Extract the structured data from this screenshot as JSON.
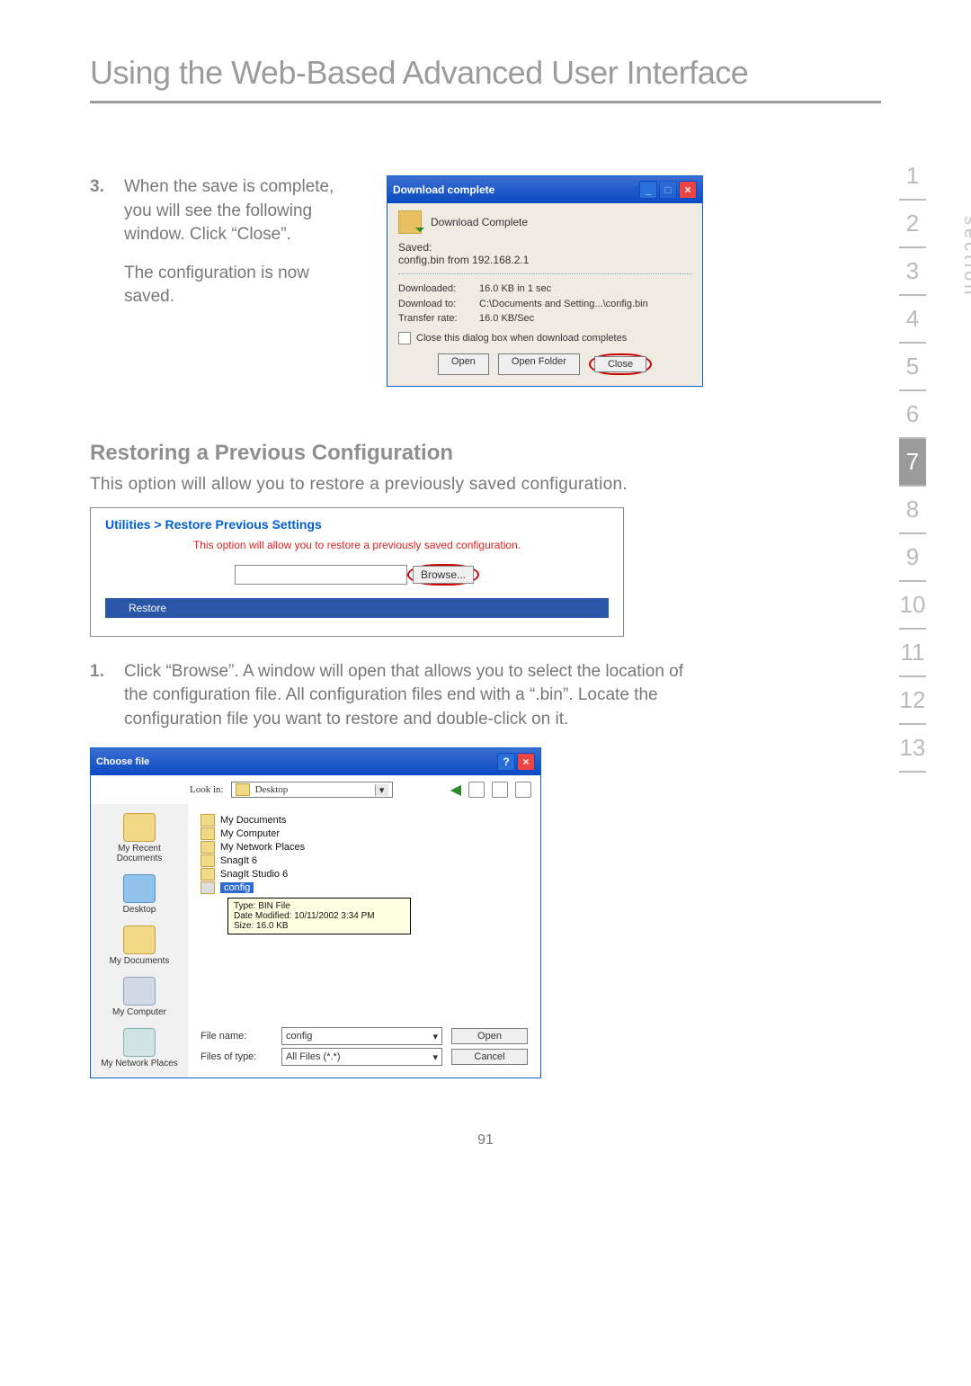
{
  "title": "Using the Web-Based Advanced User Interface",
  "page_number": "91",
  "step3": {
    "num": "3.",
    "para1": "When the save is complete, you will see the following window. Click “Close”.",
    "para2": "The configuration is now saved."
  },
  "dl": {
    "title": "Download complete",
    "header": "Download Complete",
    "saved_lbl": "Saved:",
    "saved_val": "config.bin from 192.168.2.1",
    "downloaded_lbl": "Downloaded:",
    "downloaded_val": "16.0 KB in 1 sec",
    "dlto_lbl": "Download to:",
    "dlto_val": "C:\\Documents and Setting...\\config.bin",
    "rate_lbl": "Transfer rate:",
    "rate_val": "16.0 KB/Sec",
    "checkbox": "Close this dialog box when download completes",
    "open": "Open",
    "open_folder": "Open Folder",
    "close": "Close"
  },
  "restoring_h": "Restoring a Previous Configuration",
  "restoring_lead": "This option will allow you to restore a previously saved configuration.",
  "rp": {
    "title": "Utilities > Restore Previous Settings",
    "desc": "This option will allow you to restore a previously saved configuration.",
    "browse": "Browse...",
    "restore": "Restore"
  },
  "step1": {
    "num": "1.",
    "text": "Click “Browse”. A window will open that allows you to select the location of the configuration file. All configuration files end with a “.bin”. Locate the configuration file you want to restore and double-click on it."
  },
  "cf": {
    "title": "Choose file",
    "lookin_lbl": "Look in:",
    "lookin_val": "Desktop",
    "side": {
      "recent": "My Recent Documents",
      "desktop": "Desktop",
      "docs": "My Documents",
      "comp": "My Computer",
      "net": "My Network Places"
    },
    "list": {
      "i1": "My Documents",
      "i2": "My Computer",
      "i3": "My Network Places",
      "i4": "SnagIt 6",
      "i5": "SnagIt Studio 6",
      "i6": "config"
    },
    "tooltip": {
      "l1": "Type: BIN File",
      "l2": "Date Modified: 10/11/2002 3:34 PM",
      "l3": "Size: 16.0 KB"
    },
    "fname_lbl": "File name:",
    "fname_val": "config",
    "ftype_lbl": "Files of type:",
    "ftype_val": "All Files (*.*)",
    "open": "Open",
    "cancel": "Cancel"
  },
  "section_label": "section",
  "sections": [
    "1",
    "2",
    "3",
    "4",
    "5",
    "6",
    "7",
    "8",
    "9",
    "10",
    "11",
    "12",
    "13"
  ],
  "active_section": "7"
}
